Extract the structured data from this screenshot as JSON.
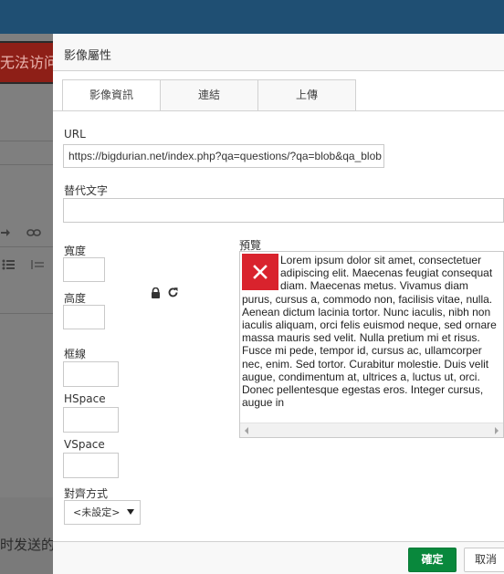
{
  "background": {
    "error_text": "无法访问",
    "bottom_text": "时发送的"
  },
  "dialog": {
    "title": "影像屬性",
    "tabs": [
      {
        "label": "影像資訊",
        "active": true
      },
      {
        "label": "連結",
        "active": false
      },
      {
        "label": "上傳",
        "active": false
      }
    ],
    "url": {
      "label": "URL",
      "value": "https://bigdurian.net/index.php?qa=questions/?qa=blob&qa_blob"
    },
    "alt": {
      "label": "替代文字",
      "value": ""
    },
    "width": {
      "label": "寬度",
      "value": ""
    },
    "height": {
      "label": "高度",
      "value": ""
    },
    "border": {
      "label": "框線",
      "value": ""
    },
    "hspace": {
      "label": "HSpace",
      "value": ""
    },
    "vspace": {
      "label": "VSpace",
      "value": ""
    },
    "align": {
      "label": "對齊方式",
      "selected": "<未設定>"
    },
    "preview": {
      "label": "預覽",
      "text": "Lorem ipsum dolor sit amet, consectetuer adipiscing elit. Maecenas feugiat consequat diam. Maecenas metus. Vivamus diam purus, cursus a, commodo non, facilisis vitae, nulla. Aenean dictum lacinia tortor. Nunc iaculis, nibh non iaculis aliquam, orci felis euismod neque, sed ornare massa mauris sed velit. Nulla pretium mi et risus. Fusce mi pede, tempor id, cursus ac, ullamcorper nec, enim. Sed tortor. Curabitur molestie. Duis velit augue, condimentum at, ultrices a, luctus ut, orci. Donec pellentesque egestas eros. Integer cursus, augue in"
    },
    "buttons": {
      "ok": "確定",
      "cancel": "取消"
    },
    "colors": {
      "ok_button": "#09883c",
      "broken_image": "#d9232d"
    }
  }
}
